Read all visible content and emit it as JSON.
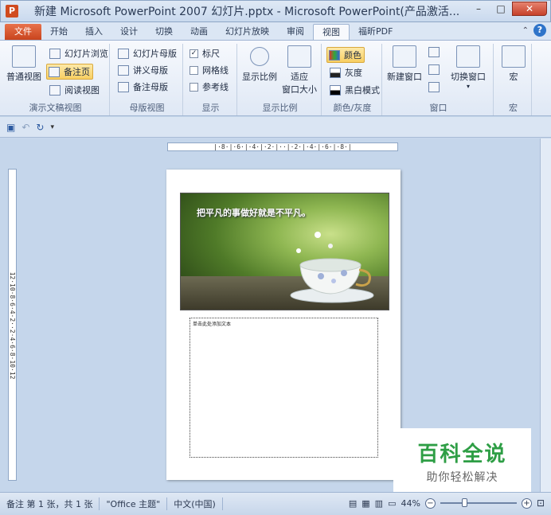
{
  "window": {
    "title": "新建 Microsoft PowerPoint 2007 幻灯片.pptx - Microsoft PowerPoint(产品激活...",
    "app_icon_letter": "P",
    "minimize": "–",
    "maximize": "□",
    "close": "✕"
  },
  "tabs": [
    {
      "label": "文件"
    },
    {
      "label": "开始"
    },
    {
      "label": "插入"
    },
    {
      "label": "设计"
    },
    {
      "label": "切换"
    },
    {
      "label": "动画"
    },
    {
      "label": "幻灯片放映"
    },
    {
      "label": "审阅"
    },
    {
      "label": "视图",
      "active": true
    },
    {
      "label": "福昕PDF"
    }
  ],
  "ribbon": {
    "presentation_views": {
      "group_label": "演示文稿视图",
      "normal": "普通视图",
      "slide_sorter": "幻灯片浏览",
      "notes_page": "备注页",
      "reading_view": "阅读视图"
    },
    "master_views": {
      "group_label": "母版视图",
      "slide_master": "幻灯片母版",
      "handout_master": "讲义母版",
      "notes_master": "备注母版"
    },
    "show": {
      "group_label": "显示",
      "ruler": "标尺",
      "gridlines": "网格线",
      "guides": "参考线",
      "ruler_checked": "✓"
    },
    "zoom": {
      "group_label": "显示比例",
      "zoom": "显示比例",
      "fit_line1": "适应",
      "fit_line2": "窗口大小"
    },
    "color": {
      "group_label": "颜色/灰度",
      "color": "颜色",
      "grayscale": "灰度",
      "black_white": "黑白模式"
    },
    "window": {
      "group_label": "窗口",
      "new_window": "新建窗口",
      "switch_windows": "切换窗口"
    },
    "macros": {
      "group_label": "宏",
      "macros": "宏"
    }
  },
  "qat": {
    "save_icon": "save-icon",
    "undo_icon": "undo-icon",
    "redo_icon": "redo-icon",
    "customize_icon": "customize-icon"
  },
  "rulers": {
    "horizontal": "|·8·|·6·|·4·|·2·|··|·2·|·4·|·6·|·8·|",
    "vertical": "12·10·8·6·4·2··2·4·6·8·10·12"
  },
  "slide": {
    "headline": "把平凡的事做好就是不平凡。"
  },
  "notes": {
    "placeholder": "单击此处添加文本"
  },
  "watermark": {
    "main": "百科全说",
    "sub": "助你轻松解决"
  },
  "statusbar": {
    "page_info": "备注 第 1 张，共 1 张",
    "theme": "\"Office 主题\"",
    "language": "中文(中国)",
    "zoom": "44%",
    "zoom_fraction": 0.3
  }
}
